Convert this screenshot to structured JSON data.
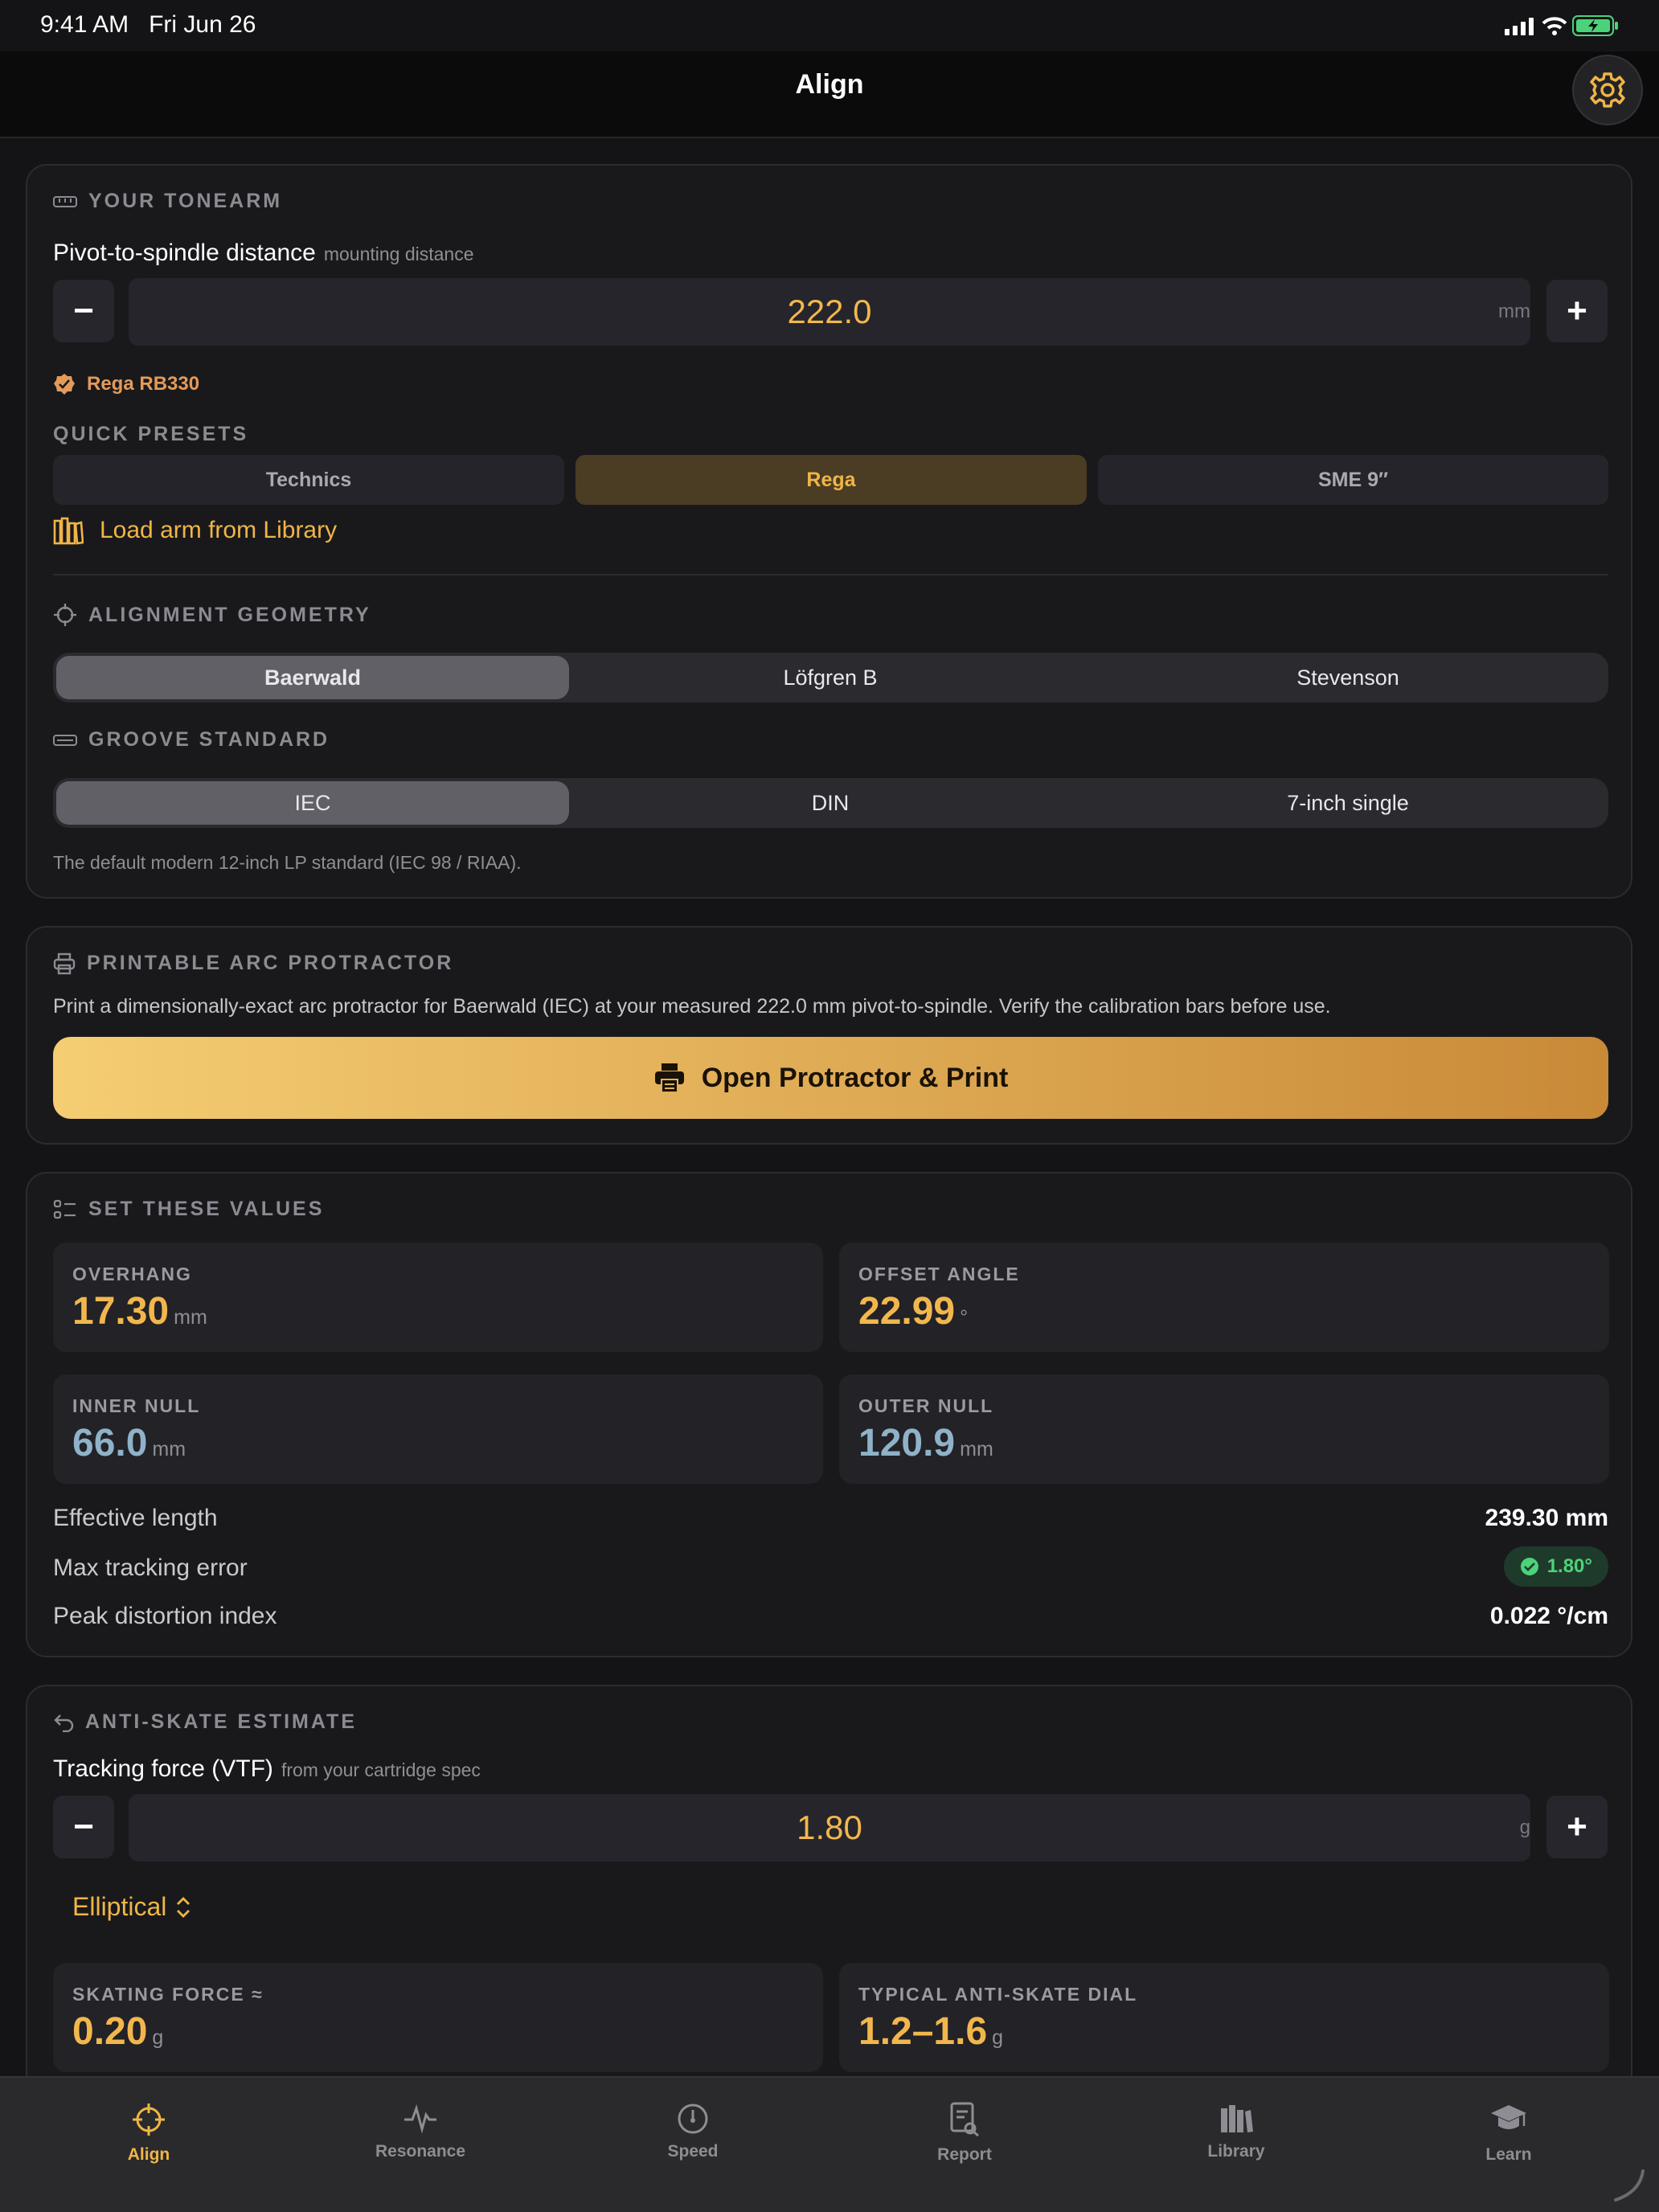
{
  "status_bar": {
    "time": "9:41 AM",
    "date": "Fri Jun 26"
  },
  "header": {
    "title": "Align",
    "settings_icon": "gear-icon"
  },
  "tonearm": {
    "section_title": "YOUR TONEARM",
    "distance_label": "Pivot-to-spindle distance",
    "distance_sublabel": "mounting distance",
    "value": "222.0",
    "unit": "mm",
    "minus": "−",
    "plus": "+",
    "matched_arm": "Rega RB330",
    "presets_title": "QUICK PRESETS",
    "presets": [
      "Technics",
      "Rega",
      "SME 9″"
    ],
    "selected_preset": "Rega",
    "load_library": "Load arm from Library"
  },
  "geometry": {
    "section_title": "ALIGNMENT GEOMETRY",
    "options": [
      "Baerwald",
      "Löfgren B",
      "Stevenson"
    ],
    "selected": "Baerwald"
  },
  "groove": {
    "section_title": "GROOVE STANDARD",
    "options": [
      "IEC",
      "DIN",
      "7-inch single"
    ],
    "selected": "IEC",
    "description": "The default modern 12-inch LP standard (IEC 98 / RIAA)."
  },
  "protractor": {
    "section_title": "PRINTABLE ARC PROTRACTOR",
    "description": "Print a dimensionally-exact arc protractor for Baerwald (IEC) at your measured 222.0 mm pivot-to-spindle. Verify the calibration bars before use.",
    "button": "Open Protractor & Print"
  },
  "values": {
    "section_title": "SET THESE VALUES",
    "tiles": [
      {
        "label": "OVERHANG",
        "value": "17.30",
        "unit": "mm",
        "color": "#f2b74c"
      },
      {
        "label": "OFFSET ANGLE",
        "value": "22.99",
        "unit": "°",
        "color": "#f2b74c"
      },
      {
        "label": "INNER NULL",
        "value": "66.0",
        "unit": "mm",
        "color": "#8fb2c8"
      },
      {
        "label": "OUTER NULL",
        "value": "120.9",
        "unit": "mm",
        "color": "#8fb2c8"
      }
    ],
    "effective_length_label": "Effective length",
    "effective_length": "239.30 mm",
    "max_error_label": "Max tracking error",
    "max_error": "1.80°",
    "peak_distortion_label": "Peak distortion index",
    "peak_distortion": "0.022 °/cm"
  },
  "antiskate": {
    "section_title": "ANTI-SKATE ESTIMATE",
    "force_label": "Tracking force (VTF)",
    "force_sublabel": "from your cartridge spec",
    "value": "1.80",
    "unit": "g",
    "stylus": "Elliptical",
    "tiles": [
      {
        "label": "SKATING FORCE ≈",
        "value": "0.20",
        "unit": "g"
      },
      {
        "label": "TYPICAL ANTI-SKATE DIAL",
        "value": "1.2–1.6",
        "unit": "g"
      }
    ]
  },
  "tabs": [
    {
      "label": "Align",
      "icon": "crosshair-icon",
      "active": true
    },
    {
      "label": "Resonance",
      "icon": "waveform-icon",
      "active": false
    },
    {
      "label": "Speed",
      "icon": "speedometer-icon",
      "active": false
    },
    {
      "label": "Report",
      "icon": "report-icon",
      "active": false
    },
    {
      "label": "Library",
      "icon": "books-icon",
      "active": false
    },
    {
      "label": "Learn",
      "icon": "graduation-cap-icon",
      "active": false
    }
  ],
  "colors": {
    "accent": "#f0b547",
    "background": "#141416",
    "card": "#19191c",
    "success": "#4cd37a",
    "gradient_start": "#f5cd72",
    "gradient_end": "#c98a38"
  }
}
